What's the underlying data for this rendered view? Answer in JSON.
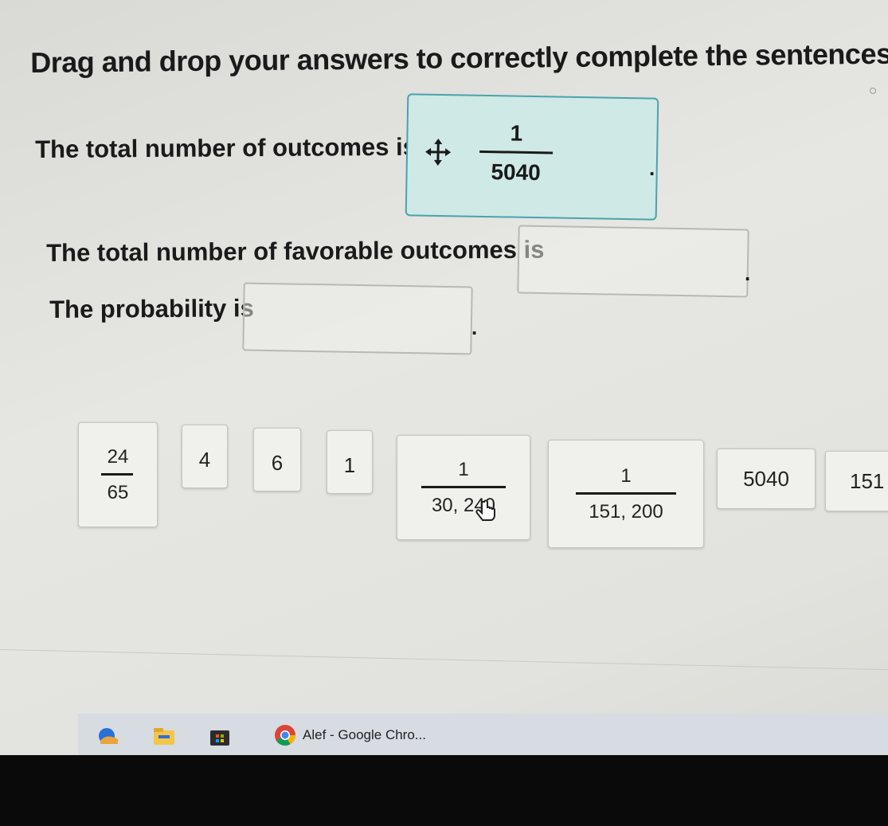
{
  "instructions": "Drag and drop your answers to correctly complete the sentences.",
  "sentences": [
    {
      "text": "The total number of outcomes is",
      "period": "."
    },
    {
      "text": "The total number of favorable outcomes is",
      "period": "."
    },
    {
      "text": "The probability is",
      "period": "."
    }
  ],
  "placed_answer": {
    "numerator": "1",
    "denominator": "5040",
    "icon": "move-arrows-icon"
  },
  "answer_tiles": [
    {
      "numerator": "24",
      "denominator": "65"
    },
    {
      "value": "4"
    },
    {
      "value": "6"
    },
    {
      "value": "1"
    },
    {
      "numerator": "1",
      "denominator": "30, 240"
    },
    {
      "numerator": "1",
      "denominator": "151, 200"
    },
    {
      "value": "5040"
    },
    {
      "value": "151"
    }
  ],
  "taskbar": {
    "icons": [
      "weather-icon",
      "file-explorer-icon",
      "store-icon",
      "chrome-icon"
    ],
    "active_window_label": "Alef - Google Chro..."
  },
  "colors": {
    "active_drop_zone": "#cfe9e6",
    "active_drop_border": "#4aa3ad",
    "tile_bg": "#f0f0ec"
  }
}
